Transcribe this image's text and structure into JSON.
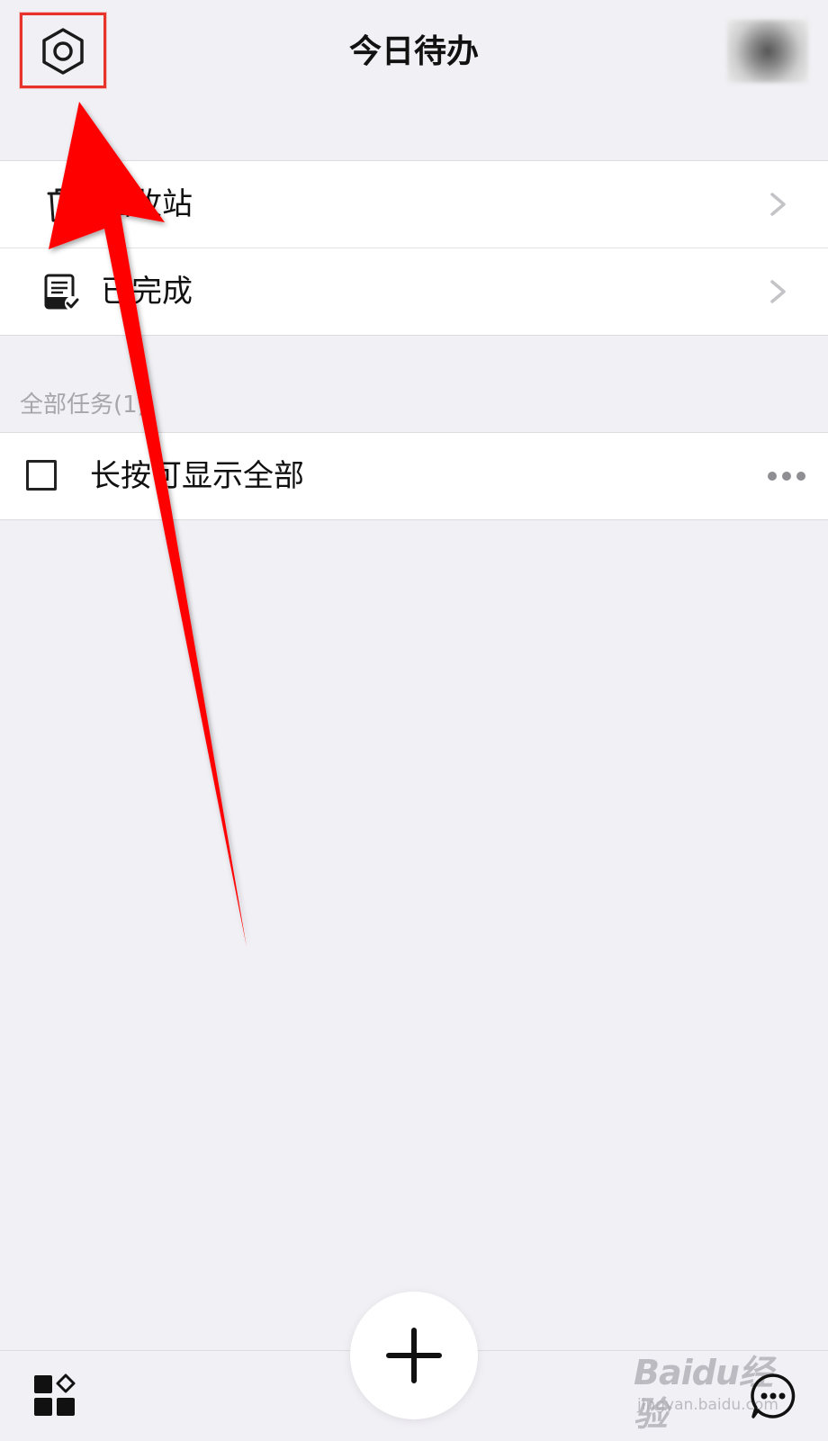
{
  "header": {
    "title": "今日待办",
    "settings_icon": "hexagon-gear-icon",
    "avatar": "user-avatar-blurred"
  },
  "menu": {
    "items": [
      {
        "label": "回收站",
        "icon": "trash-icon"
      },
      {
        "label": "已完成",
        "icon": "completed-list-icon"
      }
    ]
  },
  "tasks": {
    "section_title": "全部任务(1)",
    "items": [
      {
        "label": "长按可显示全部",
        "checked": false
      }
    ]
  },
  "bottom_bar": {
    "left_icon": "apps-grid-icon",
    "center_icon": "add-icon",
    "right_icon": "chat-more-icon"
  },
  "watermark": {
    "main": "Baidu经验",
    "sub": "jingyan.baidu.com"
  },
  "colors": {
    "background": "#f1f0f5",
    "highlight": "#e8332b",
    "arrow": "#ff0000"
  }
}
